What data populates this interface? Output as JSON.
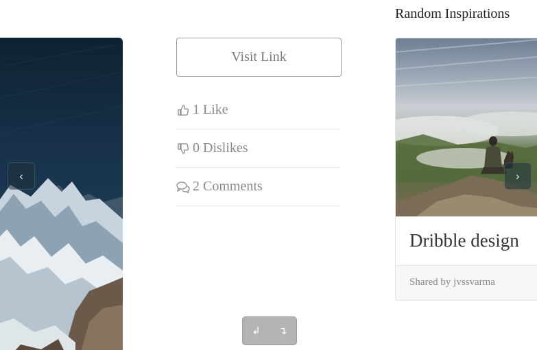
{
  "carousel": {
    "prev_icon": "chevron-left-icon",
    "next_icon": "chevron-right-icon",
    "prev_glyph": "‹",
    "next_glyph": "›"
  },
  "post": {
    "visit_link_label": "Visit Link",
    "likes": {
      "icon": "thumbs-up-icon",
      "label": "1 Like"
    },
    "dislikes": {
      "icon": "thumbs-down-icon",
      "label": "0 Dislikes"
    },
    "comments": {
      "icon": "comments-icon",
      "label": "2 Comments"
    }
  },
  "history_controls": {
    "undo_icon": "undo-icon",
    "redo_icon": "redo-icon",
    "undo_glyph": "↲",
    "redo_glyph": "↴"
  },
  "sidebar": {
    "title": "Random Inspirations",
    "card": {
      "title": "Dribble design",
      "shared_by": "Shared by jvssvarma"
    }
  },
  "colors": {
    "text_muted": "#8a8a8a",
    "border": "#9a9a9a",
    "pill_bg": "#b4b4b4"
  }
}
